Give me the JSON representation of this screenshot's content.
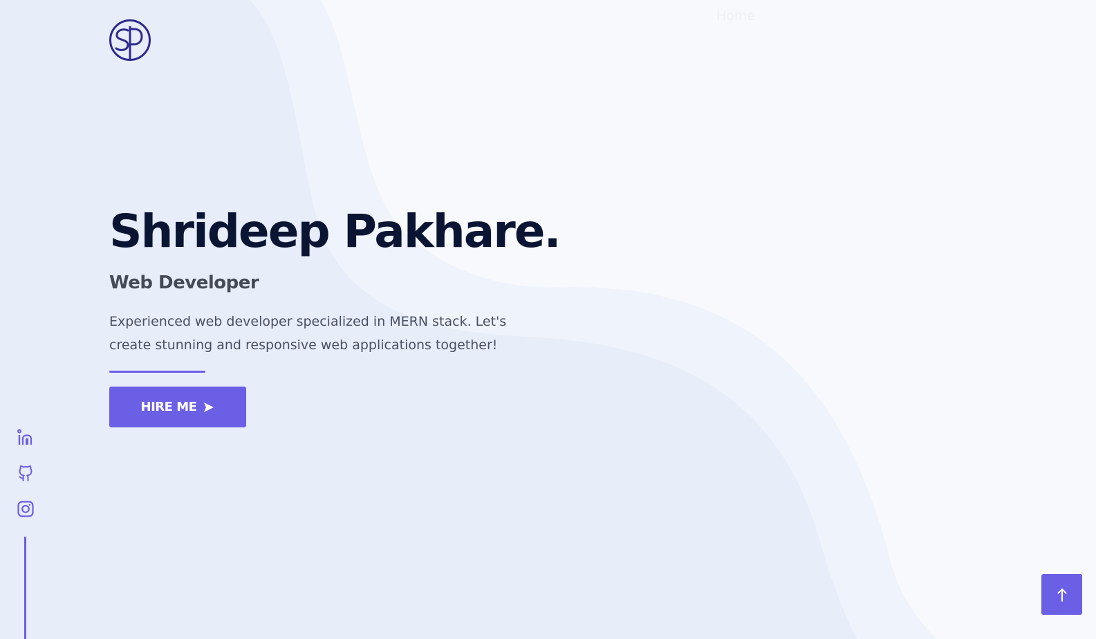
{
  "nav": {
    "home_label": "Home"
  },
  "logo": {
    "text": "SP"
  },
  "hero": {
    "name": "Shrideep Pakhare.",
    "role": "Web Developer",
    "description": "Experienced web developer specialized in MERN stack. Let's create stunning and responsive web applications together!",
    "hire_label": "HIRE ME"
  },
  "social": {
    "items": [
      {
        "name": "linkedin",
        "icon": "linkedin-icon"
      },
      {
        "name": "github",
        "icon": "github-icon"
      },
      {
        "name": "instagram",
        "icon": "instagram-icon"
      }
    ]
  },
  "colors": {
    "accent": "#6b5fe6",
    "heading": "#0a1533",
    "subheading": "#454a57",
    "body_text": "#4b5060",
    "background": "#f8f9fc",
    "wave_light": "#eff3fb",
    "wave_mid": "#e7edf9"
  },
  "icons": {
    "scroll_top": "arrow-up-icon",
    "hire_arrow": "play-arrow-icon"
  }
}
